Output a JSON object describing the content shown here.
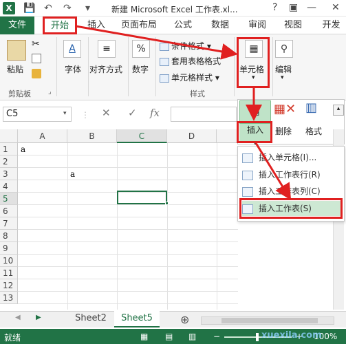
{
  "window": {
    "app_logo": "X",
    "title": "新建 Microsoft Excel 工作表.xl...",
    "help": "?",
    "restore": "▣",
    "minimize": "—",
    "close": "✕"
  },
  "qat": {
    "save_icon": "💾",
    "undo_icon": "↶",
    "redo_icon": "↷",
    "customize_icon": "▾"
  },
  "tabs": {
    "file": "文件",
    "items": [
      "开始",
      "插入",
      "页面布局",
      "公式",
      "数据",
      "审阅",
      "视图",
      "开发"
    ]
  },
  "ribbon": {
    "paste": "粘贴",
    "clipboard": "剪贴板",
    "font": "字体",
    "align": "对齐方式",
    "number": "数字",
    "cond_format": "条件格式",
    "table_format": "套用表格格式",
    "cell_style": "单元格样式",
    "styles": "样式",
    "cells": "单元格",
    "edit": "编辑"
  },
  "formula_bar": {
    "namebox": "C5",
    "fx": "fx",
    "cancel": "✕",
    "enter": "✓"
  },
  "grid": {
    "columns": [
      "A",
      "B",
      "C",
      "D"
    ],
    "rows": [
      "1",
      "2",
      "3",
      "4",
      "5",
      "6",
      "7",
      "8",
      "9",
      "10",
      "11",
      "12",
      "13"
    ],
    "cells": {
      "A1": "a",
      "B3": "a"
    },
    "selected_cell": "C5"
  },
  "insert_panel": {
    "insert": "插入",
    "delete": "删除",
    "format": "格式"
  },
  "insert_menu": [
    "插入单元格(I)...",
    "插入工作表行(R)",
    "插入工作表列(C)",
    "插入工作表(S)"
  ],
  "sheets": {
    "tabs": [
      "Sheet2",
      "Sheet5"
    ],
    "active": "Sheet5",
    "add": "⊕"
  },
  "status": {
    "ready": "就绪",
    "zoom": "100%",
    "watermark": "xuexila.com"
  },
  "colors": {
    "excel_green": "#217346",
    "highlight_red": "#e02020"
  }
}
